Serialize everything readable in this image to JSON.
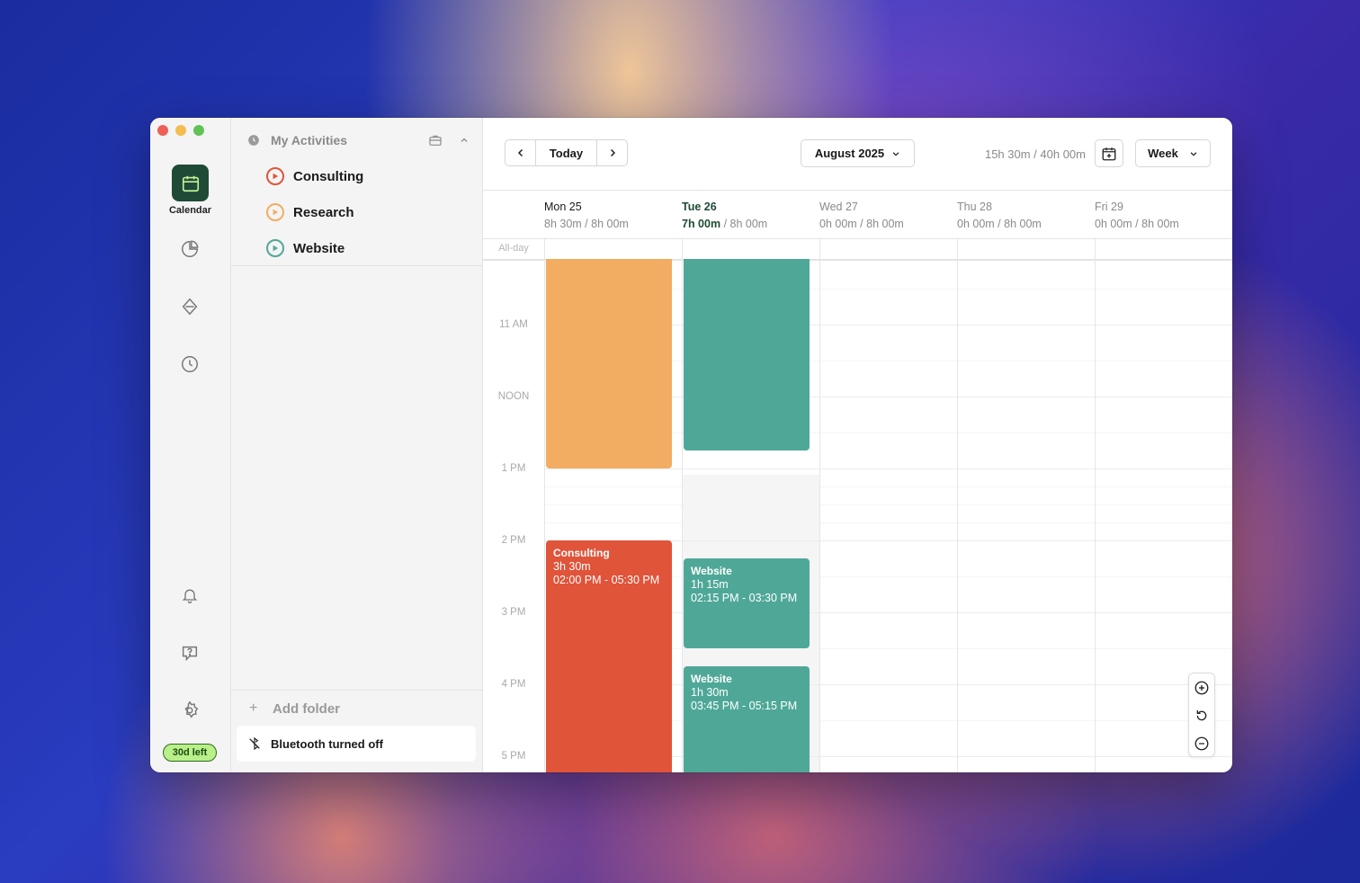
{
  "app": {
    "trial_badge": "30d left",
    "rail": {
      "calendar_label": "Calendar"
    }
  },
  "sidebar": {
    "section_title": "My Activities",
    "activities": [
      {
        "label": "Consulting",
        "color": "#e0543a"
      },
      {
        "label": "Research",
        "color": "#f2ad63"
      },
      {
        "label": "Website",
        "color": "#4fa897"
      }
    ],
    "add_folder_label": "Add folder",
    "bluetooth_status": "Bluetooth turned off"
  },
  "toolbar": {
    "today_label": "Today",
    "month_label": "August 2025",
    "total_hours": "15h 30m / 40h 00m",
    "view_label": "Week"
  },
  "days": [
    {
      "name": "Mon 25",
      "tracked": "8h 30m",
      "target": " / 8h 00m"
    },
    {
      "name": "Tue 26",
      "tracked": "7h 00m",
      "target": " / 8h 00m"
    },
    {
      "name": "Wed 27",
      "tracked": "0h 00m",
      "target": " / 8h 00m"
    },
    {
      "name": "Thu 28",
      "tracked": "0h 00m",
      "target": " / 8h 00m"
    },
    {
      "name": "Fri 29",
      "tracked": "0h 00m",
      "target": " / 8h 00m"
    }
  ],
  "allday_label": "All-day",
  "time_labels": [
    "11 AM",
    "NOON",
    "1 PM",
    "2 PM",
    "3 PM",
    "4 PM",
    "5 PM"
  ],
  "events": [
    {
      "title": "Consulting",
      "duration": "3h 30m",
      "range": "02:00 PM - 05:30 PM",
      "color": "#e0543a"
    },
    {
      "title": "Website",
      "duration": "1h 15m",
      "range": "02:15 PM - 03:30 PM",
      "color": "#4fa897"
    },
    {
      "title": "Website",
      "duration": "1h 30m",
      "range": "03:45 PM - 05:15 PM",
      "color": "#4fa897"
    }
  ],
  "colors": {
    "accent": "#1f4a35",
    "research": "#f2ad63",
    "website": "#4fa897",
    "consulting": "#e0543a"
  },
  "icons": [
    "calendar-icon",
    "reports-icon",
    "tags-icon",
    "history-icon",
    "bell-icon",
    "help-icon",
    "settings-icon",
    "bluetooth-off-icon",
    "zoom-in-icon",
    "zoom-reset-icon",
    "zoom-out-icon"
  ]
}
